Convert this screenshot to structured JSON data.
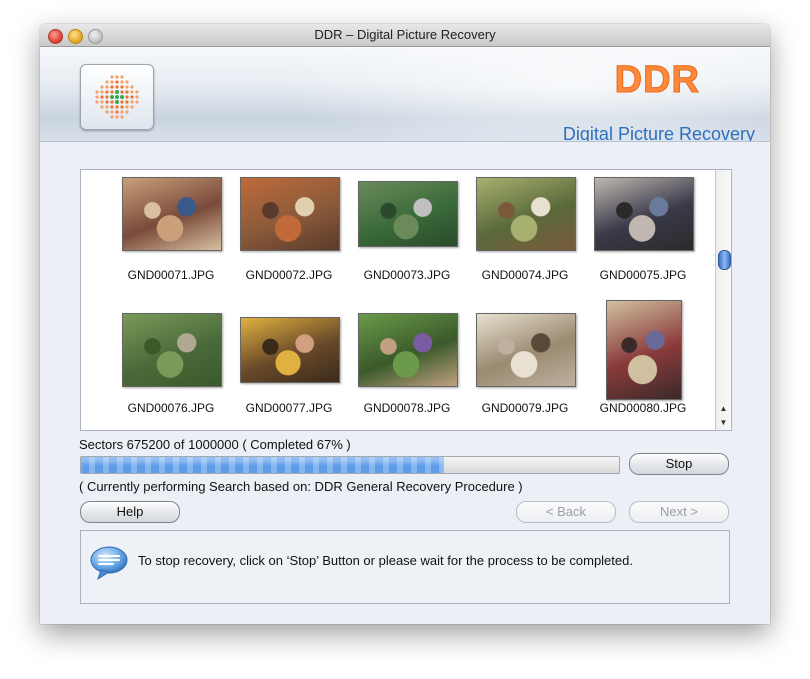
{
  "window": {
    "title": "DDR – Digital Picture Recovery"
  },
  "header": {
    "brand": "DDR",
    "subtitle": "Digital Picture Recovery"
  },
  "thumbnails": [
    {
      "name": "GND00071.JPG"
    },
    {
      "name": "GND00072.JPG"
    },
    {
      "name": "GND00073.JPG"
    },
    {
      "name": "GND00074.JPG"
    },
    {
      "name": "GND00075.JPG"
    },
    {
      "name": "GND00076.JPG"
    },
    {
      "name": "GND00077.JPG"
    },
    {
      "name": "GND00078.JPG"
    },
    {
      "name": "GND00079.JPG"
    },
    {
      "name": "GND00080.JPG"
    }
  ],
  "progress": {
    "sectors_text": "Sectors 675200 of 1000000   ( Completed 67% )",
    "completed_fraction": 0.675,
    "status_text": "( Currently performing Search based on: DDR General Recovery Procedure )"
  },
  "buttons": {
    "stop": "Stop",
    "help": "Help",
    "back": "< Back",
    "next": "Next >"
  },
  "info": {
    "message": "To stop recovery, click on ‘Stop’ Button or please wait for the process to be completed.",
    "icon": "speech-bubble-icon"
  },
  "colors": {
    "brand_orange": "#ff8a3d",
    "subtitle_blue": "#2d6fc0",
    "progress_blue": "#5d9be8"
  }
}
